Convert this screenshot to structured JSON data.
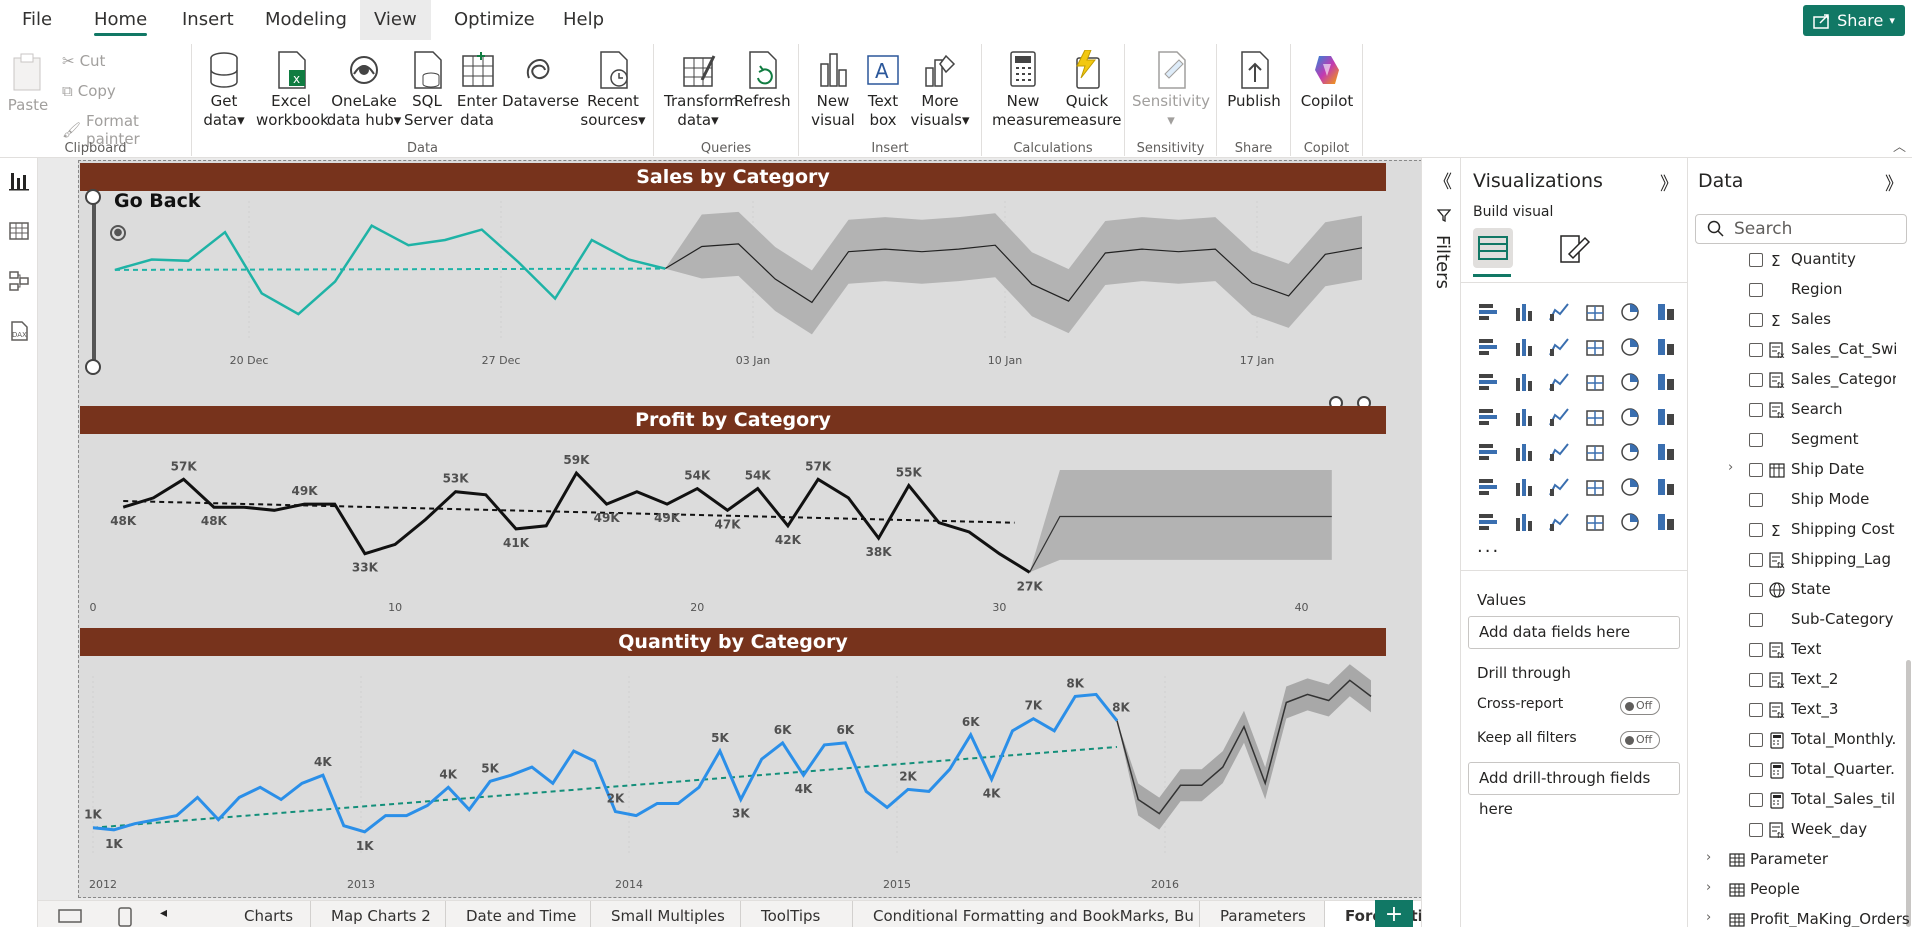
{
  "menu": {
    "items": [
      "File",
      "Home",
      "Insert",
      "Modeling",
      "View",
      "Optimize",
      "Help"
    ],
    "active": "Home",
    "highlighted": "View",
    "share_label": "Share"
  },
  "ribbon": {
    "clipboard": {
      "paste": "Paste",
      "cut": "Cut",
      "copy": "Copy",
      "format_painter": "Format painter",
      "caption": "Clipboard"
    },
    "data": {
      "get_data": [
        "Get",
        "data"
      ],
      "excel": [
        "Excel",
        "workbook"
      ],
      "onelake": [
        "OneLake",
        "data hub"
      ],
      "sql": [
        "SQL",
        "Server"
      ],
      "enter": [
        "Enter",
        "data"
      ],
      "dataverse": "Dataverse",
      "recent": [
        "Recent",
        "sources"
      ],
      "caption": "Data"
    },
    "queries": {
      "transform": [
        "Transform",
        "data"
      ],
      "refresh": "Refresh",
      "caption": "Queries"
    },
    "insert": {
      "new_visual": [
        "New",
        "visual"
      ],
      "text_box": [
        "Text",
        "box"
      ],
      "more_visuals": [
        "More",
        "visuals"
      ],
      "caption": "Insert"
    },
    "calculations": {
      "new_measure": [
        "New",
        "measure"
      ],
      "quick_measure": [
        "Quick",
        "measure"
      ],
      "caption": "Calculations"
    },
    "sensitivity": {
      "label": "Sensitivity",
      "caption": "Sensitivity"
    },
    "share": {
      "publish": "Publish",
      "caption": "Share"
    },
    "copilot": {
      "label": "Copilot",
      "caption": "Copilot"
    }
  },
  "report": {
    "go_back": "Go Back",
    "charts": [
      {
        "title": "Sales by Category"
      },
      {
        "title": "Profit by Category"
      },
      {
        "title": "Quantity by Category"
      }
    ]
  },
  "chart_data": [
    {
      "type": "line",
      "title": "Sales by Category",
      "x_ticks": [
        "20 Dec",
        "27 Dec",
        "03 Jan",
        "10 Jan",
        "17 Jan"
      ],
      "series": [
        {
          "values": [
            0.47,
            0.55,
            0.54,
            0.76,
            0.29,
            0.13,
            0.38,
            0.81,
            0.66,
            0.7,
            0.78,
            0.53,
            0.25,
            0.7,
            0.55,
            0.48
          ]
        }
      ],
      "forecast": {
        "values": [
          0.48,
          0.65,
          0.67,
          0.4,
          0.22,
          0.61,
          0.63,
          0.61,
          0.63,
          0.66,
          0.36,
          0.23,
          0.6,
          0.63,
          0.61,
          0.63,
          0.37,
          0.27,
          0.59,
          0.64
        ]
      },
      "trend": "flat"
    },
    {
      "type": "line",
      "title": "Profit by Category",
      "x_ticks": [
        "0",
        "10",
        "20",
        "30",
        "40"
      ],
      "xlim": [
        0,
        42
      ],
      "series": [
        {
          "x": [
            1,
            2,
            3,
            4,
            5,
            6,
            7,
            8,
            9,
            10,
            11,
            12,
            13,
            14,
            15,
            16,
            17,
            18,
            19,
            20,
            21,
            22,
            23,
            24,
            25,
            26,
            27,
            28,
            29,
            30,
            31
          ],
          "values": [
            48,
            51,
            57,
            48,
            48,
            47,
            49,
            49,
            33,
            36,
            44,
            53,
            52,
            41,
            42,
            59,
            49,
            53,
            49,
            54,
            47,
            54,
            42,
            57,
            51,
            38,
            55,
            43,
            40,
            33,
            27
          ]
        }
      ],
      "data_labels": [
        {
          "x": 1,
          "text": "48K"
        },
        {
          "x": 3,
          "text": "57K"
        },
        {
          "x": 4,
          "text": "48K"
        },
        {
          "x": 7,
          "text": "49K"
        },
        {
          "x": 9,
          "text": "33K"
        },
        {
          "x": 12,
          "text": "53K"
        },
        {
          "x": 14,
          "text": "41K"
        },
        {
          "x": 16,
          "text": "59K"
        },
        {
          "x": 17,
          "text": "49K"
        },
        {
          "x": 19,
          "text": "49K"
        },
        {
          "x": 20,
          "text": "54K"
        },
        {
          "x": 21,
          "text": "47K"
        },
        {
          "x": 22,
          "text": "54K"
        },
        {
          "x": 23,
          "text": "42K"
        },
        {
          "x": 24,
          "text": "57K"
        },
        {
          "x": 26,
          "text": "38K"
        },
        {
          "x": 27,
          "text": "55K"
        },
        {
          "x": 31,
          "text": "27K"
        }
      ],
      "forecast": {
        "x": [
          31,
          32,
          33,
          41
        ],
        "values": [
          27,
          45,
          45,
          45
        ]
      }
    },
    {
      "type": "line",
      "title": "Quantity by Category",
      "x_ticks": [
        "2012",
        "2013",
        "2014",
        "2015",
        "2016"
      ],
      "series": [
        {
          "values": [
            1.3,
            1.2,
            1.5,
            1.7,
            1.9,
            2.8,
            1.7,
            2.8,
            3.3,
            2.7,
            3.5,
            3.9,
            1.4,
            1.1,
            1.9,
            1.9,
            2.4,
            3.3,
            2.2,
            3.6,
            3.9,
            4.3,
            3.5,
            5.1,
            4.6,
            2.1,
            1.9,
            2.5,
            2.5,
            3.3,
            5.1,
            2.7,
            4.7,
            5.5,
            3.9,
            5.4,
            5.5,
            3.1,
            2.3,
            3.2,
            3.1,
            4.2,
            5.9,
            3.7,
            6.1,
            6.7,
            6.1,
            7.8,
            7.9,
            6.6
          ]
        }
      ],
      "data_labels": [
        "1K",
        "1K",
        "4K",
        "1K",
        "4K",
        "5K",
        "2K",
        "5K",
        "3K",
        "6K",
        "4K",
        "6K",
        "2K",
        "6K",
        "4K",
        "7K",
        "8K",
        "8K"
      ],
      "forecast": {
        "values": [
          6.6,
          2.7,
          2.0,
          3.4,
          3.4,
          4.3,
          6.3,
          3.5,
          7.5,
          7.9,
          7.6,
          8.6,
          7.8
        ]
      },
      "trend": "increasing"
    }
  ],
  "pagetabs": [
    "Charts",
    "Map Charts 2",
    "Date and Time",
    "Small Multiples",
    "ToolTips",
    "Conditional Formatting and BookMarks, Bu",
    "Parameters",
    "Forecasting"
  ],
  "pagetab_active": "Forecasting",
  "filters": {
    "label": "Filters"
  },
  "viz": {
    "title": "Visualizations",
    "build_visual": "Build visual",
    "values_label": "Values",
    "values_placeholder": "Add data fields here",
    "drill_through": "Drill through",
    "cross_report": "Cross-report",
    "keep_all_filters": "Keep all filters",
    "toggle_off": "Off",
    "drill_placeholder": "Add drill-through fields here",
    "more": "..."
  },
  "datapane": {
    "title": "Data",
    "search_placeholder": "Search",
    "fields": [
      {
        "name": "Quantity",
        "icon": "sigma"
      },
      {
        "name": "Region",
        "icon": "none"
      },
      {
        "name": "Sales",
        "icon": "sigma"
      },
      {
        "name": "Sales_Cat_Swit",
        "icon": "calc"
      },
      {
        "name": "Sales_Category",
        "icon": "calc"
      },
      {
        "name": "Search",
        "icon": "calc"
      },
      {
        "name": "Segment",
        "icon": "none"
      },
      {
        "name": "Ship Date",
        "icon": "calendar",
        "expandable": true
      },
      {
        "name": "Ship Mode",
        "icon": "none"
      },
      {
        "name": "Shipping Cost",
        "icon": "sigma"
      },
      {
        "name": "Shipping_Lag",
        "icon": "calc"
      },
      {
        "name": "State",
        "icon": "globe"
      },
      {
        "name": "Sub-Category",
        "icon": "none"
      },
      {
        "name": "Text",
        "icon": "calc"
      },
      {
        "name": "Text_2",
        "icon": "calc"
      },
      {
        "name": "Text_3",
        "icon": "calc"
      },
      {
        "name": "Total_Monthly...",
        "icon": "measure"
      },
      {
        "name": "Total_Quarter...",
        "icon": "measure"
      },
      {
        "name": "Total_Sales_till...",
        "icon": "measure"
      },
      {
        "name": "Week_day",
        "icon": "calc"
      }
    ],
    "tables": [
      "Parameter",
      "People",
      "Profit_MaKing_Orders"
    ]
  }
}
